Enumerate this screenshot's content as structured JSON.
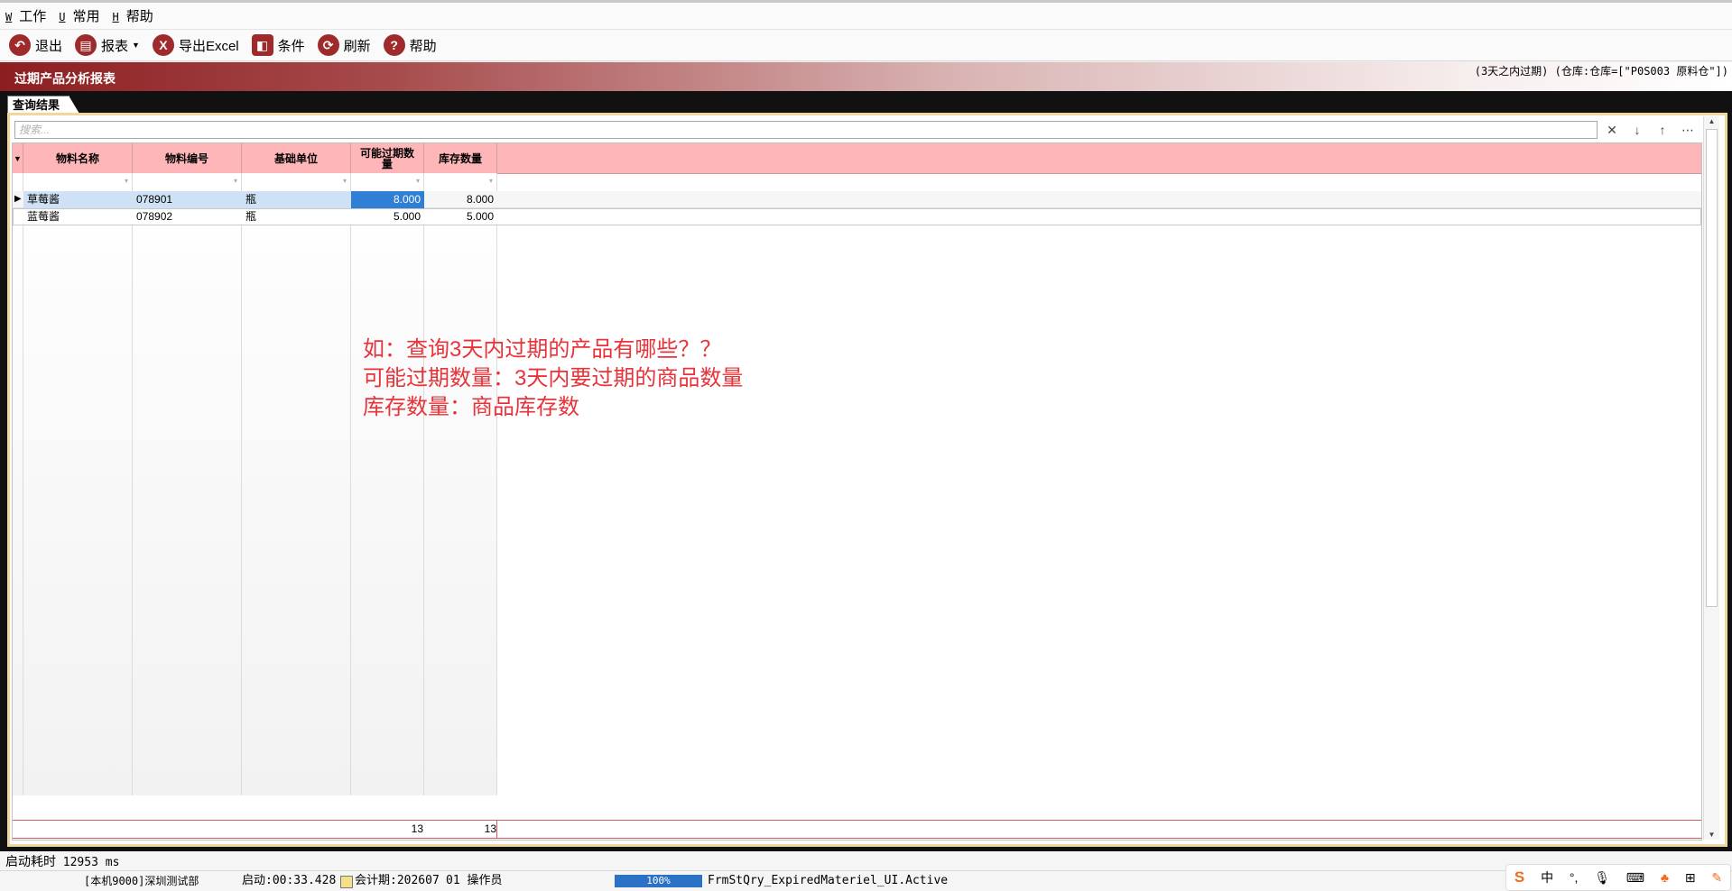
{
  "menu": [
    {
      "accel": "W",
      "label": "工作"
    },
    {
      "accel": "U",
      "label": "常用"
    },
    {
      "accel": "H",
      "label": "帮助"
    }
  ],
  "toolbar": {
    "exit": "退出",
    "report": "报表",
    "export_excel": "导出Excel",
    "conditions": "条件",
    "refresh": "刷新",
    "help": "帮助"
  },
  "report": {
    "title": "过期产品分析报表",
    "condition": "(3天之内过期) (仓库:仓库=[\"P0S003 原料仓\"])"
  },
  "tab": {
    "label": "查询结果"
  },
  "search": {
    "placeholder": "搜索..."
  },
  "grid": {
    "columns": [
      "物料名称",
      "物料编号",
      "基础单位",
      "可能过期数量",
      "库存数量"
    ],
    "rows": [
      {
        "name": "草莓酱",
        "code": "078901",
        "unit": "瓶",
        "expiring": "8.000",
        "stock": "8.000"
      },
      {
        "name": "蓝莓酱",
        "code": "078902",
        "unit": "瓶",
        "expiring": "5.000",
        "stock": "5.000"
      }
    ],
    "totals": {
      "expiring": "13",
      "stock": "13"
    }
  },
  "annotation": {
    "line1": "如：查询3天内过期的产品有哪些？？",
    "line2": "可能过期数量：3天内要过期的商品数量",
    "line3": "库存数量：商品库存数"
  },
  "status": {
    "startup_label": "启动耗时",
    "startup_value": "12953 ms",
    "machine": "[本机9000]深圳测试部",
    "start_time": "启动:00:33.428",
    "period": "会计期:202607",
    "operator": "01 操作员",
    "progress": "100%",
    "form": "FrmStQry_ExpiredMateriel_UI.Active"
  },
  "ime": {
    "mode": "中"
  },
  "colors": {
    "accent": "#9e2a2b",
    "header": "#ffb6b8",
    "annotation": "#e8333a",
    "selection": "#2f7fd4"
  }
}
